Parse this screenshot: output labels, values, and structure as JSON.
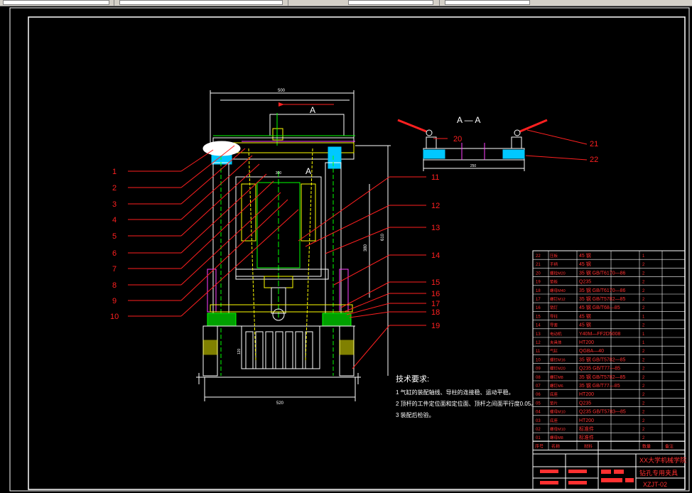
{
  "toolbar": {
    "field_a": "",
    "field_b": "",
    "field_c": ""
  },
  "section": {
    "view_letter": "A",
    "section_title": "A — A"
  },
  "dimensions": {
    "top_width": "500",
    "mid_width": "300",
    "bottom_width": "520",
    "right_height": "610",
    "inner_height": "380",
    "base_height": "120",
    "section_width": "250"
  },
  "part_labels": [
    "1",
    "2",
    "3",
    "4",
    "5",
    "6",
    "7",
    "8",
    "9",
    "10",
    "11",
    "12",
    "13",
    "14",
    "15",
    "16",
    "17",
    "18",
    "19",
    "20",
    "21",
    "22"
  ],
  "tech_requirements": {
    "title": "技术要求:",
    "items": [
      "1  气缸的装配轴线、导柱的连接稳、运动平稳。",
      "2  顶杆的工件定位面和定位面、顶杆之间面平行度0.05。",
      "3  装配后检验。"
    ]
  },
  "bom": {
    "rows": [
      {
        "no": "22",
        "name": "压板",
        "material": "45 钢",
        "qty": "1"
      },
      {
        "no": "21",
        "name": "手柄",
        "material": "45 钢",
        "qty": "2"
      },
      {
        "no": "20",
        "name": "螺栓M20",
        "material": "35 钢 GB/T6170—86",
        "qty": "2"
      },
      {
        "no": "19",
        "name": "垫板",
        "material": "Q235",
        "qty": "2"
      },
      {
        "no": "18",
        "name": "螺母M40",
        "material": "35 钢 GB/T6170—86",
        "qty": "2"
      },
      {
        "no": "17",
        "name": "螺钉M12",
        "material": "35 钢 GB/T5782—85",
        "qty": "2"
      },
      {
        "no": "16",
        "name": "销钉",
        "material": "45 钢 GB/T68—85",
        "qty": "2"
      },
      {
        "no": "15",
        "name": "导柱",
        "material": "45 钢",
        "qty": "1"
      },
      {
        "no": "14",
        "name": "导套",
        "material": "45 钢",
        "qty": "2"
      },
      {
        "no": "13",
        "name": "电动机",
        "material": "Y40M—FF2D5008",
        "qty": "1"
      },
      {
        "no": "12",
        "name": "夹具体",
        "material": "HT200",
        "qty": "1"
      },
      {
        "no": "11",
        "name": "气缸",
        "material": "QGBA—40",
        "qty": "2"
      },
      {
        "no": "10",
        "name": "螺钉M16",
        "material": "35 钢 GB/T5782—85",
        "qty": "2"
      },
      {
        "no": "09",
        "name": "螺钉M20",
        "material": "Q235 GB/T77—85",
        "qty": "2"
      },
      {
        "no": "08",
        "name": "螺钉M8",
        "material": "35 钢 GB/T5782—85",
        "qty": "2"
      },
      {
        "no": "07",
        "name": "螺钉M6",
        "material": "35 钢 GB/T77—85",
        "qty": "2"
      },
      {
        "no": "06",
        "name": "底座",
        "material": "HT200",
        "qty": "2"
      },
      {
        "no": "05",
        "name": "垫片",
        "material": "Q235",
        "qty": "2"
      },
      {
        "no": "04",
        "name": "螺母M10",
        "material": "Q235 GB/T5783—85",
        "qty": "2"
      },
      {
        "no": "03",
        "name": "底座",
        "material": "HT200",
        "qty": "2"
      },
      {
        "no": "02",
        "name": "螺母M10",
        "material": "标准件",
        "qty": "2"
      },
      {
        "no": "01",
        "name": "螺母M8",
        "material": "标准件",
        "qty": "2"
      }
    ],
    "header": {
      "no": "序号",
      "name": "名称",
      "material": "材料",
      "qty": "数量",
      "remark": "备注"
    }
  },
  "title_block": {
    "school": "XX大学机械学院",
    "drawing_name": "钻孔专用夹具",
    "drawing_no": "XZJT-02"
  },
  "colors": {
    "frame": "#ffffff",
    "leader": "#ff2020",
    "table": "#ff3030",
    "detail_green": "#00ff00",
    "detail_yellow": "#ffff00",
    "detail_magenta": "#ff40ff",
    "detail_cyan": "#00c8ff"
  }
}
